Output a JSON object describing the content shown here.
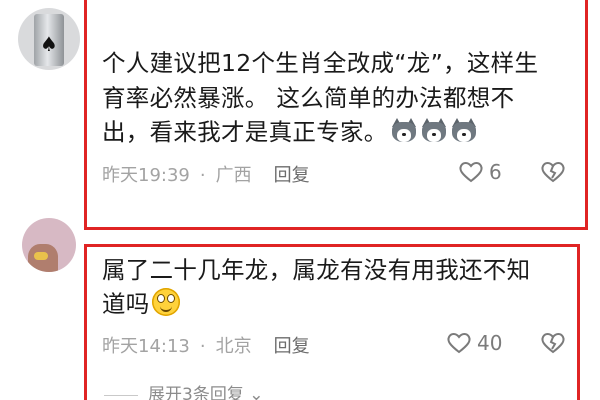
{
  "comments": [
    {
      "text_lines": [
        "个人建议把12个生肖全改成“龙”，这样生",
        "育率必然暴涨。 这么简单的办法都想不",
        "出，看来我才是真正专家。"
      ],
      "emoji": [
        "husky-emoji",
        "husky-emoji",
        "husky-emoji"
      ],
      "time": "昨天19:39",
      "separator": "·",
      "location": "广西",
      "reply_label": "回复",
      "like_count": "6"
    },
    {
      "text_lines": [
        "属了二十几年龙，属龙有没有用我还不知",
        "道吗"
      ],
      "emoji": [
        "smile-emoji"
      ],
      "time": "昨天14:13",
      "separator": "·",
      "location": "北京",
      "reply_label": "回复",
      "like_count": "40"
    }
  ],
  "expand_replies": "展开3条回复",
  "colors": {
    "highlight": "#e02424",
    "meta_text": "#a3a3a3",
    "body_text": "#1a1a1a"
  }
}
